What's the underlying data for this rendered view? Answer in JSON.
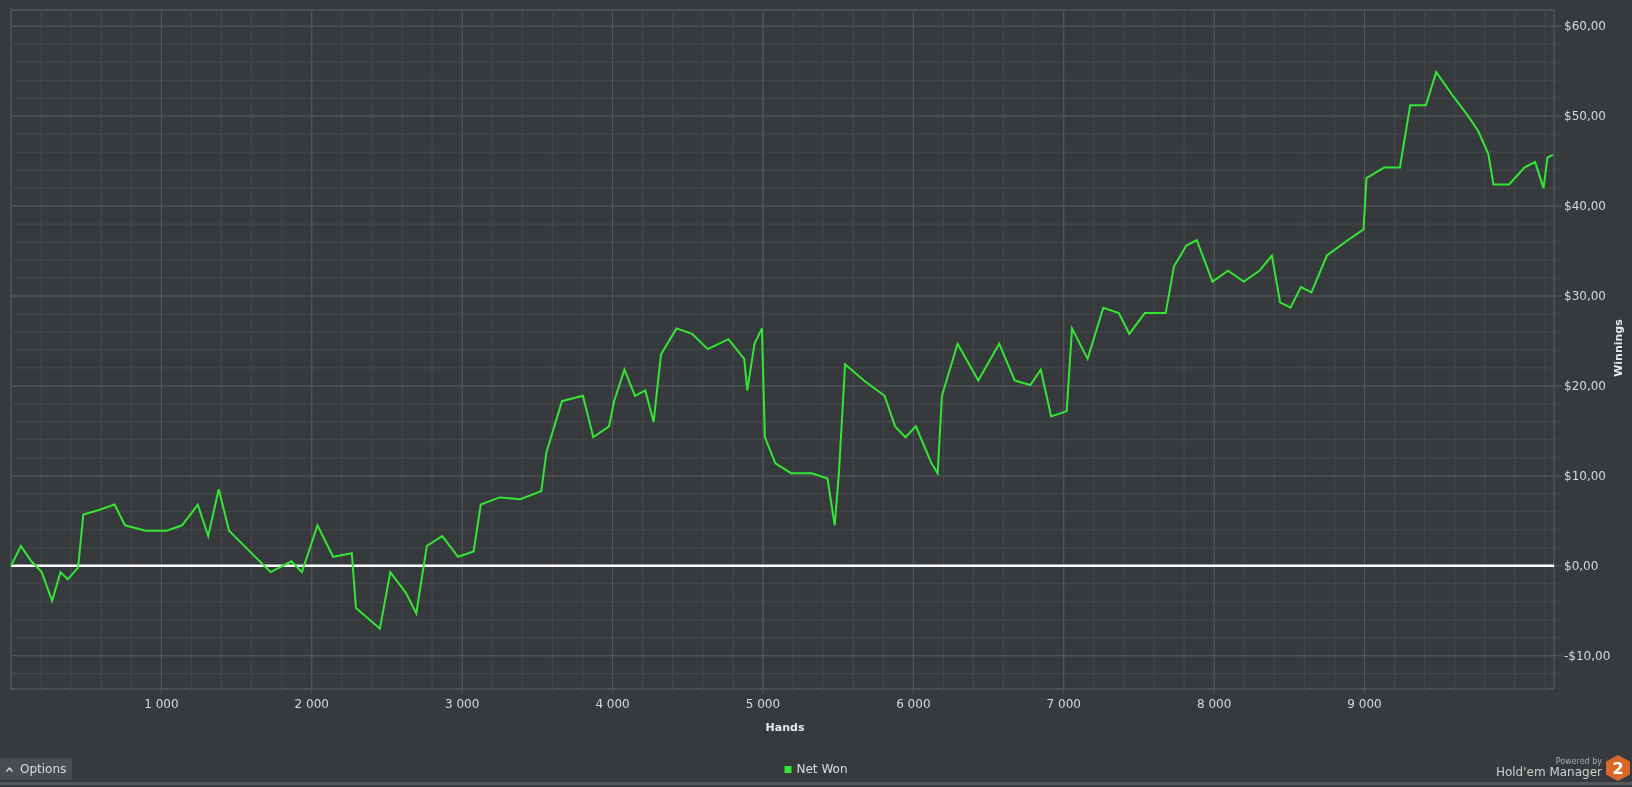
{
  "chart": {
    "chart_data": {
      "type": "line",
      "grid": true,
      "xlabel": "Hands",
      "ylabel": "Winnings",
      "xlim": [
        0,
        10260
      ],
      "ylim": [
        -13.7,
        61.8
      ],
      "xticks": [
        {
          "value": 1000,
          "label": "1 000"
        },
        {
          "value": 2000,
          "label": "2 000"
        },
        {
          "value": 3000,
          "label": "3 000"
        },
        {
          "value": 4000,
          "label": "4 000"
        },
        {
          "value": 5000,
          "label": "5 000"
        },
        {
          "value": 6000,
          "label": "6 000"
        },
        {
          "value": 7000,
          "label": "7 000"
        },
        {
          "value": 8000,
          "label": "8 000"
        },
        {
          "value": 9000,
          "label": "9 000"
        }
      ],
      "yticks": [
        {
          "value": -10,
          "label": "-$10,00"
        },
        {
          "value": 0,
          "label": "$0,00"
        },
        {
          "value": 10,
          "label": "$10,00"
        },
        {
          "value": 20,
          "label": "$20,00"
        },
        {
          "value": 30,
          "label": "$30,00"
        },
        {
          "value": 40,
          "label": "$40,00"
        },
        {
          "value": 50,
          "label": "$50,00"
        },
        {
          "value": 60,
          "label": "$60,00"
        }
      ],
      "x": [
        0,
        66,
        135,
        204,
        273,
        329,
        377,
        446,
        481,
        585,
        689,
        758,
        896,
        1035,
        1138,
        1242,
        1311,
        1381,
        1450,
        1588,
        1727,
        1865,
        1934,
        2038,
        2142,
        2266,
        2294,
        2419,
        2453,
        2522,
        2626,
        2695,
        2765,
        2868,
        2972,
        3076,
        3124,
        3249,
        3387,
        3526,
        3560,
        3664,
        3803,
        3872,
        3976,
        4010,
        4079,
        4149,
        4218,
        4273,
        4322,
        4425,
        4529,
        4633,
        4771,
        4875,
        4896,
        4944,
        4993,
        5013,
        5083,
        5187,
        5325,
        5429,
        5477,
        5505,
        5546,
        5671,
        5809,
        5879,
        5948,
        6017,
        6121,
        6162,
        6190,
        6294,
        6432,
        6571,
        6674,
        6778,
        6847,
        6917,
        7020,
        7055,
        7159,
        7263,
        7366,
        7436,
        7539,
        7678,
        7733,
        7816,
        7885,
        7989,
        8093,
        8197,
        8301,
        8384,
        8439,
        8508,
        8577,
        8647,
        8750,
        8889,
        8993,
        9013,
        9131,
        9235,
        9304,
        9408,
        9477,
        9581,
        9685,
        9754,
        9823,
        9858,
        9961,
        10065,
        10134,
        10190,
        10217,
        10252
      ],
      "series": [
        {
          "name": "Net Won",
          "color": "#33e633",
          "values": [
            0,
            2.2,
            0.5,
            -0.7,
            -3.9,
            -0.7,
            -1.5,
            -0.2,
            5.7,
            6.2,
            6.8,
            4.5,
            3.9,
            3.9,
            4.5,
            6.8,
            3.3,
            8.5,
            3.9,
            1.6,
            -0.7,
            0.5,
            -0.7,
            4.5,
            1.0,
            1.4,
            -4.7,
            -6.5,
            -7.0,
            -0.7,
            -3.0,
            -5.3,
            2.2,
            3.3,
            1.0,
            1.6,
            6.8,
            7.6,
            7.4,
            8.3,
            12.6,
            18.3,
            18.9,
            14.3,
            15.5,
            18.3,
            21.8,
            18.9,
            19.5,
            16.0,
            23.5,
            26.4,
            25.8,
            24.1,
            25.2,
            23.0,
            19.5,
            24.7,
            26.4,
            14.3,
            11.4,
            10.3,
            10.3,
            9.7,
            4.5,
            10.3,
            22.4,
            20.6,
            18.9,
            15.5,
            14.3,
            15.5,
            11.4,
            10.3,
            18.9,
            24.7,
            20.6,
            24.7,
            20.6,
            20.1,
            21.8,
            16.6,
            17.2,
            26.4,
            23.0,
            28.7,
            28.1,
            25.8,
            28.1,
            28.1,
            33.3,
            35.6,
            36.2,
            31.6,
            32.8,
            31.6,
            32.8,
            34.5,
            29.3,
            28.7,
            31.0,
            30.4,
            34.5,
            36.2,
            37.4,
            43.1,
            44.3,
            44.3,
            51.2,
            51.2,
            54.9,
            52.4,
            50.1,
            48.4,
            45.8,
            42.4,
            42.4,
            44.3,
            44.9,
            42.0,
            45.4,
            45.7
          ]
        }
      ]
    }
  },
  "footer": {
    "options_button": "Options",
    "powered_by": "Powered by",
    "brand": "Hold'em Manager",
    "logo_text": "2"
  }
}
